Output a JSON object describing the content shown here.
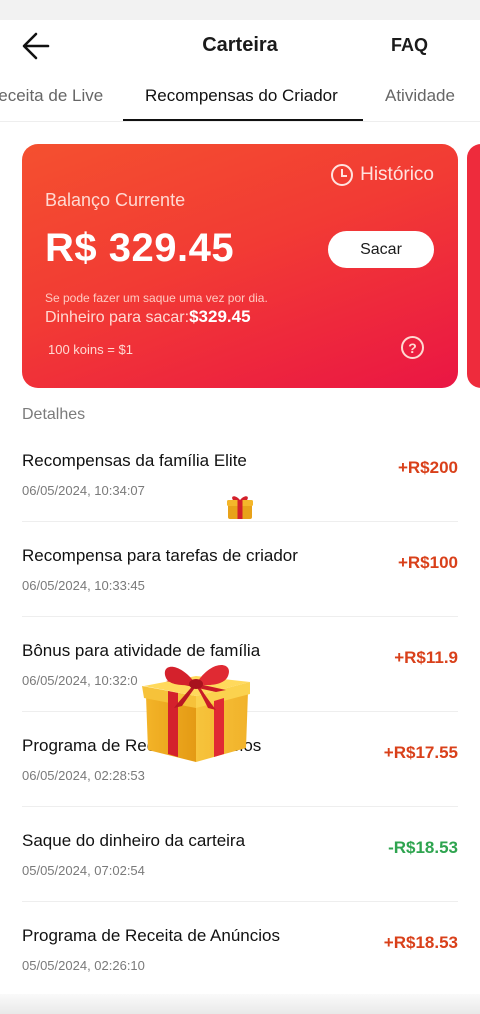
{
  "header": {
    "title": "Carteira",
    "faq": "FAQ",
    "back_icon": "arrow-left-icon"
  },
  "tabs": [
    {
      "label": "Receita de Live",
      "active": false
    },
    {
      "label": "Recompensas do Criador",
      "active": true
    },
    {
      "label": "Atividade",
      "active": false
    }
  ],
  "card": {
    "history_label": "Histórico",
    "history_icon": "clock-icon",
    "balance_label": "Balanço Currente",
    "balance_amount": "R$ 329.45",
    "withdraw_button": "Sacar",
    "note": "Se pode fazer um saque uma vez por dia.",
    "withdrawable_label": "Dinheiro para sacar:",
    "withdrawable_amount": "$329.45",
    "rate": "100 koins = $1",
    "help_icon": "question-circle-icon",
    "gradient_colors": [
      "#f4502f",
      "#f23b34",
      "#ea1644"
    ]
  },
  "details": {
    "title": "Detalhes",
    "items": [
      {
        "title": "Recompensas da família Elite",
        "date": "06/05/2024, 10:34:07",
        "amount": "+R$200",
        "sign": "pos"
      },
      {
        "title": "Recompensa para tarefas de criador",
        "date": "06/05/2024, 10:33:45",
        "amount": "+R$100",
        "sign": "pos"
      },
      {
        "title": "Bônus para atividade de família",
        "date": "06/05/2024, 10:32:0",
        "amount": "+R$11.9",
        "sign": "pos"
      },
      {
        "title": "Programa de Rece",
        "title_end": "núncios",
        "date": "06/05/2024, 02:28:53",
        "amount": "+R$17.55",
        "sign": "pos"
      },
      {
        "title": "Saque do dinheiro da carteira",
        "date": "05/05/2024, 07:02:54",
        "amount": "-R$18.53",
        "sign": "neg"
      },
      {
        "title": "Programa de Receita de Anúncios",
        "date": "05/05/2024, 02:26:10",
        "amount": "+R$18.53",
        "sign": "pos"
      }
    ]
  },
  "colors": {
    "positive": "#d9401a",
    "negative": "#2ea44f"
  },
  "overlays": {
    "small_gift_icon": "gift-icon",
    "large_gift_icon": "gift-box-icon"
  }
}
